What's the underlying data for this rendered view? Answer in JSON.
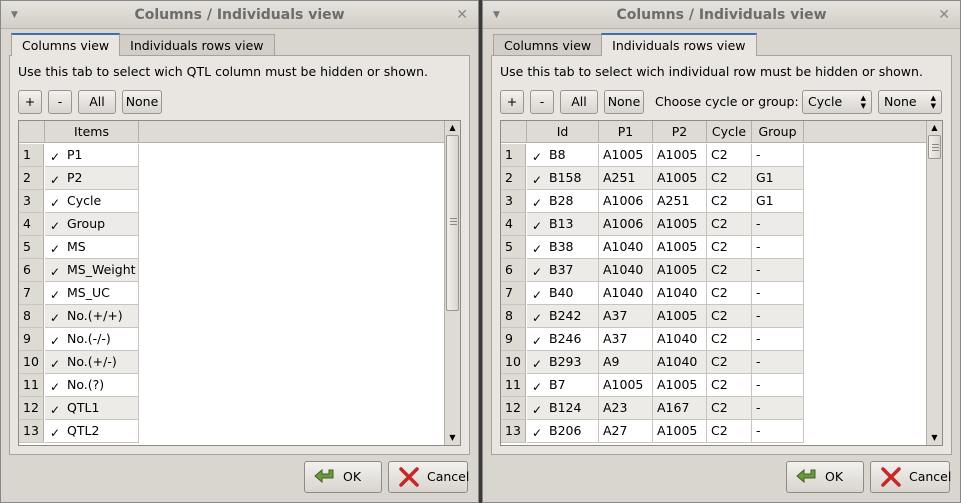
{
  "left": {
    "title": "Columns / Individuals view",
    "tabs": [
      "Columns view",
      "Individuals rows view"
    ],
    "description": "Use this tab to select wich QTL column must be hidden or shown.",
    "buttons": {
      "plus": "+",
      "minus": "-",
      "all": "All",
      "none": "None"
    },
    "table_header": "Items",
    "rows": [
      {
        "num": "1",
        "label": "P1",
        "checked": true
      },
      {
        "num": "2",
        "label": "P2",
        "checked": true
      },
      {
        "num": "3",
        "label": "Cycle",
        "checked": true
      },
      {
        "num": "4",
        "label": "Group",
        "checked": true
      },
      {
        "num": "5",
        "label": "MS",
        "checked": true
      },
      {
        "num": "6",
        "label": "MS_Weight",
        "checked": true
      },
      {
        "num": "7",
        "label": "MS_UC",
        "checked": true
      },
      {
        "num": "8",
        "label": "No.(+/+)",
        "checked": true
      },
      {
        "num": "9",
        "label": "No.(-/-)",
        "checked": true
      },
      {
        "num": "10",
        "label": "No.(+/-)",
        "checked": true
      },
      {
        "num": "11",
        "label": "No.(?)",
        "checked": true
      },
      {
        "num": "12",
        "label": "QTL1",
        "checked": true
      },
      {
        "num": "13",
        "label": "QTL2",
        "checked": true
      }
    ],
    "ok": "OK",
    "cancel": "Cancel"
  },
  "right": {
    "title": "Columns / Individuals view",
    "tabs": [
      "Columns view",
      "Individuals rows view"
    ],
    "description": "Use this tab to select wich individual row must be hidden or shown.",
    "buttons": {
      "plus": "+",
      "minus": "-",
      "all": "All",
      "none": "None"
    },
    "choose_label": "Choose cycle or group:",
    "combo1": "Cycle",
    "combo2": "None",
    "columns": [
      "Id",
      "P1",
      "P2",
      "Cycle",
      "Group"
    ],
    "rows": [
      {
        "num": "1",
        "id": "B8",
        "p1": "A1005",
        "p2": "A1005",
        "cycle": "C2",
        "group": "-"
      },
      {
        "num": "2",
        "id": "B158",
        "p1": "A251",
        "p2": "A1005",
        "cycle": "C2",
        "group": "G1"
      },
      {
        "num": "3",
        "id": "B28",
        "p1": "A1006",
        "p2": "A251",
        "cycle": "C2",
        "group": "G1"
      },
      {
        "num": "4",
        "id": "B13",
        "p1": "A1006",
        "p2": "A1005",
        "cycle": "C2",
        "group": "-"
      },
      {
        "num": "5",
        "id": "B38",
        "p1": "A1040",
        "p2": "A1005",
        "cycle": "C2",
        "group": "-"
      },
      {
        "num": "6",
        "id": "B37",
        "p1": "A1040",
        "p2": "A1005",
        "cycle": "C2",
        "group": "-"
      },
      {
        "num": "7",
        "id": "B40",
        "p1": "A1040",
        "p2": "A1040",
        "cycle": "C2",
        "group": "-"
      },
      {
        "num": "8",
        "id": "B242",
        "p1": "A37",
        "p2": "A1005",
        "cycle": "C2",
        "group": "-"
      },
      {
        "num": "9",
        "id": "B246",
        "p1": "A37",
        "p2": "A1040",
        "cycle": "C2",
        "group": "-"
      },
      {
        "num": "10",
        "id": "B293",
        "p1": "A9",
        "p2": "A1040",
        "cycle": "C2",
        "group": "-"
      },
      {
        "num": "11",
        "id": "B7",
        "p1": "A1005",
        "p2": "A1005",
        "cycle": "C2",
        "group": "-"
      },
      {
        "num": "12",
        "id": "B124",
        "p1": "A23",
        "p2": "A167",
        "cycle": "C2",
        "group": "-"
      },
      {
        "num": "13",
        "id": "B206",
        "p1": "A27",
        "p2": "A1005",
        "cycle": "C2",
        "group": "-"
      }
    ],
    "ok": "OK",
    "cancel": "Cancel"
  }
}
